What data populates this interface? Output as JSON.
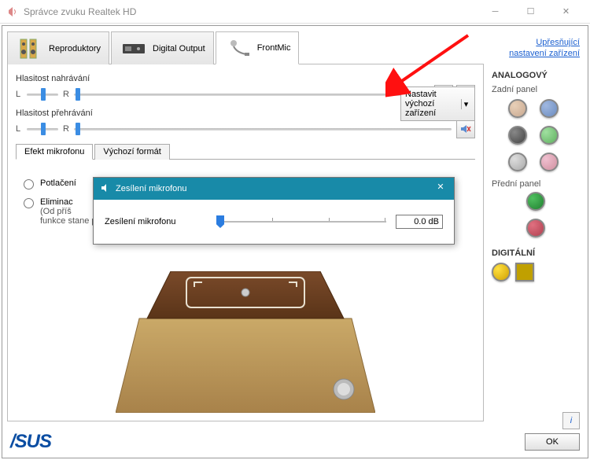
{
  "window": {
    "title": "Správce zvuku Realtek HD"
  },
  "tabs": [
    {
      "label": "Reproduktory"
    },
    {
      "label": "Digital Output"
    },
    {
      "label": "FrontMic"
    }
  ],
  "recording": {
    "label": "Hlasitost nahrávání",
    "L": "L",
    "R": "R"
  },
  "playback": {
    "label": "Hlasitost přehrávání",
    "L": "L",
    "R": "R"
  },
  "default_device": {
    "line1": "Nastavit",
    "line2": "výchozí zařízení"
  },
  "subtabs": {
    "effect": "Efekt mikrofonu",
    "format": "Výchozí formát"
  },
  "effects": {
    "opt1": "Potlačení",
    "opt2": "Eliminac",
    "opt2_sub": "(Od příš\nfunkce stane platnou.)"
  },
  "modal": {
    "title": "Zesílení mikrofonu",
    "label": "Zesílení mikrofonu",
    "value": "0.0 dB"
  },
  "side": {
    "advanced_link": "Upřesňující\nnastavení zařízení",
    "analog": "ANALOGOVÝ",
    "back": "Zadní panel",
    "front": "Přední panel",
    "digital": "DIGITÁLNÍ"
  },
  "ok": "OK",
  "jack_colors": {
    "back": [
      "#c8a890",
      "#6b8cc0",
      "#555",
      "#78c878",
      "#b8b8b8",
      "#d090a0"
    ],
    "front": [
      "#2a9040",
      "#c04050"
    ],
    "digital": [
      "#e8b000",
      "#c0a000"
    ]
  }
}
